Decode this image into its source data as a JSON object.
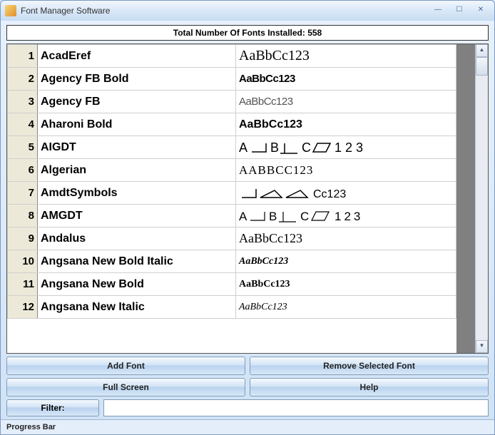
{
  "window": {
    "title": "Font Manager Software"
  },
  "summary": "Total Number Of Fonts Installed: 558",
  "fonts": [
    {
      "num": "1",
      "name": "AcadEref",
      "sample": "AaBbCc123",
      "style": "font-family:Georgia,serif;font-size:20px;"
    },
    {
      "num": "2",
      "name": "Agency FB Bold",
      "sample": "AaBbCc123",
      "style": "font-family:'Arial Narrow',Arial,sans-serif;font-weight:bold;font-size:15px;letter-spacing:-0.5px;"
    },
    {
      "num": "3",
      "name": "Agency FB",
      "sample": "AaBbCc123",
      "style": "font-family:'Arial Narrow',Arial,sans-serif;font-size:15px;letter-spacing:-0.5px;color:#555;"
    },
    {
      "num": "4",
      "name": "Aharoni Bold",
      "sample": "AaBbCc123",
      "style": "font-family:Arial,sans-serif;font-weight:bold;font-size:16px;"
    },
    {
      "num": "5",
      "name": "AIGDT",
      "sample": "",
      "svg": "aigdt"
    },
    {
      "num": "6",
      "name": "Algerian",
      "sample": "AABBCC123",
      "style": "font-family:'Times New Roman',serif;font-size:17px;letter-spacing:1px;"
    },
    {
      "num": "7",
      "name": "AmdtSymbols",
      "sample": "",
      "svg": "amdt"
    },
    {
      "num": "8",
      "name": "AMGDT",
      "sample": "",
      "svg": "amgdt"
    },
    {
      "num": "9",
      "name": "Andalus",
      "sample": "AaBbCc123",
      "style": "font-family:'Times New Roman',serif;font-size:18px;"
    },
    {
      "num": "10",
      "name": "Angsana New Bold Italic",
      "sample": "AaBbCc123",
      "style": "font-family:'Times New Roman',serif;font-style:italic;font-weight:bold;font-size:14px;"
    },
    {
      "num": "11",
      "name": "Angsana New Bold",
      "sample": "AaBbCc123",
      "style": "font-family:'Times New Roman',serif;font-weight:bold;font-size:14px;"
    },
    {
      "num": "12",
      "name": "Angsana New Italic",
      "sample": "AaBbCc123",
      "style": "font-family:'Times New Roman',serif;font-style:italic;font-size:14px;"
    }
  ],
  "buttons": {
    "add": "Add Font",
    "remove": "Remove Selected Font",
    "fullscreen": "Full Screen",
    "help": "Help"
  },
  "filter": {
    "label": "Filter:",
    "value": ""
  },
  "status": "Progress Bar"
}
